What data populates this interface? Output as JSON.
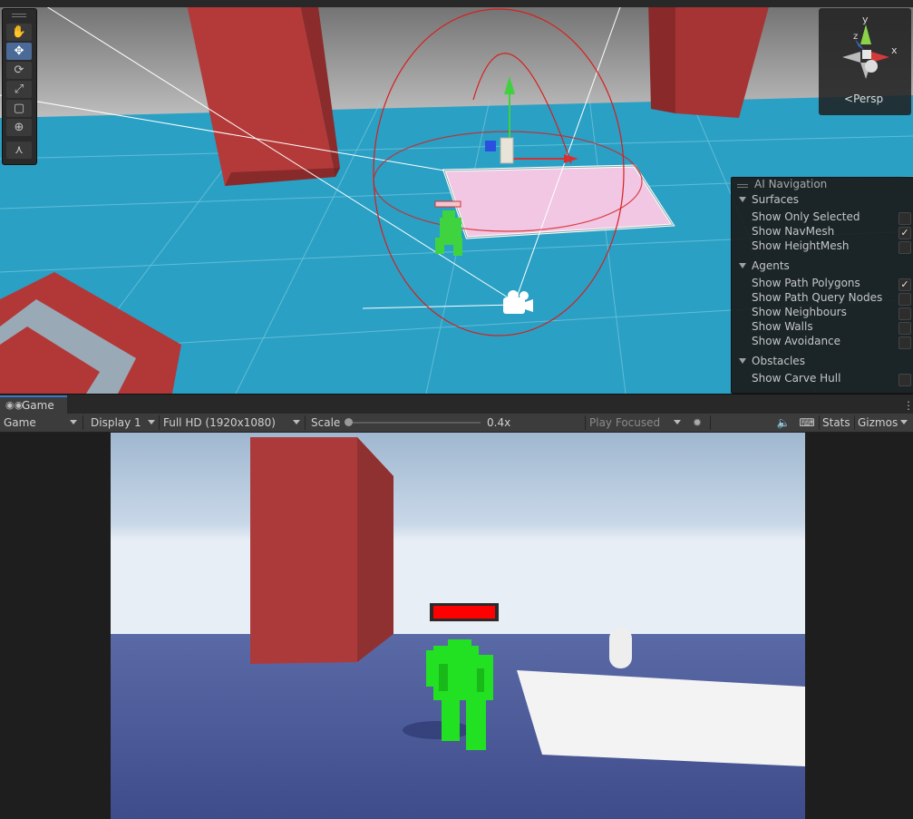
{
  "scene": {
    "persp_label": "Persp",
    "gizmo_axes": {
      "y": "y",
      "x": "x",
      "z": "z"
    },
    "tools": [
      {
        "name": "hand-tool-icon",
        "glyph": "✋"
      },
      {
        "name": "move-tool-icon",
        "glyph": "✥"
      },
      {
        "name": "rotate-tool-icon",
        "glyph": "⟳"
      },
      {
        "name": "scale-tool-icon",
        "glyph": "⤢"
      },
      {
        "name": "rect-tool-icon",
        "glyph": "▢"
      },
      {
        "name": "transform-tool-icon",
        "glyph": "⊕"
      },
      {
        "name": "custom-tool-icon",
        "glyph": "⋏"
      }
    ]
  },
  "ai_navigation": {
    "title": "AI Navigation",
    "surfaces": {
      "label": "Surfaces",
      "items": [
        {
          "label": "Show Only Selected",
          "checked": false
        },
        {
          "label": "Show NavMesh",
          "checked": true
        },
        {
          "label": "Show HeightMesh",
          "checked": false
        }
      ]
    },
    "agents": {
      "label": "Agents",
      "items": [
        {
          "label": "Show Path Polygons",
          "checked": true
        },
        {
          "label": "Show Path Query Nodes",
          "checked": false
        },
        {
          "label": "Show Neighbours",
          "checked": false
        },
        {
          "label": "Show Walls",
          "checked": false
        },
        {
          "label": "Show Avoidance",
          "checked": false
        }
      ]
    },
    "obstacles": {
      "label": "Obstacles",
      "items": [
        {
          "label": "Show Carve Hull",
          "checked": false
        }
      ]
    }
  },
  "game": {
    "tab_label": "Game",
    "toolbar": {
      "view_mode": "Game",
      "display": "Display 1",
      "resolution": "Full HD (1920x1080)",
      "scale_label": "Scale",
      "scale_value": "0.4x",
      "play_mode": "Play Focused",
      "stats_label": "Stats",
      "gizmos_label": "Gizmos"
    },
    "health_fraction": 1.0
  },
  "colors": {
    "floor": "#2aa0c4",
    "pillar": "#b43a3a",
    "character": "#22e022",
    "active_tool": "#4a6b98",
    "health": "#ff0000"
  }
}
